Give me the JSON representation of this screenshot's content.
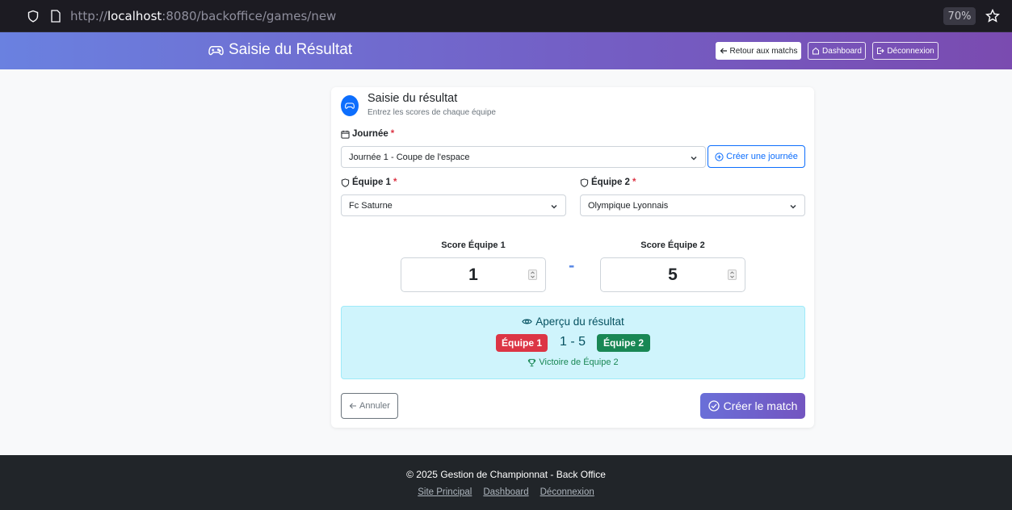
{
  "browser": {
    "url_prefix": "http://",
    "url_host": "localhost",
    "url_path": ":8080/backoffice/games/new",
    "zoom": "70%"
  },
  "header": {
    "title": "Saisie du Résultat",
    "back_label": "Retour aux matchs",
    "dashboard_label": "Dashboard",
    "logout_label": "Déconnexion"
  },
  "card": {
    "title": "Saisie du résultat",
    "subtitle": "Entrez les scores de chaque équipe",
    "journee_label": "Journée",
    "journee_value": "Journée 1 - Coupe de l'espace",
    "create_journee_label": "Créer une journée",
    "team1_label": "Équipe 1",
    "team1_value": "Fc Saturne",
    "team2_label": "Équipe 2",
    "team2_value": "Olympique Lyonnais",
    "required_mark": "*",
    "score1_label": "Score Équipe 1",
    "score1_value": "1",
    "score2_label": "Score Équipe 2",
    "score2_value": "5",
    "separator": "-"
  },
  "preview": {
    "title": "Aperçu du résultat",
    "team1_badge": "Équipe 1",
    "score": "1 - 5",
    "team2_badge": "Équipe 2",
    "result_text": "Victoire de Équipe 2"
  },
  "actions": {
    "cancel_label": "Annuler",
    "create_label": "Créer le match"
  },
  "footer": {
    "copyright": "© 2025 Gestion de Championnat - Back Office",
    "links": [
      "Site Principal",
      "Dashboard",
      "Déconnexion"
    ]
  },
  "colors": {
    "primary": "#0d6efd",
    "danger": "#dc3545",
    "success": "#198754",
    "info_bg": "#cff4fc",
    "header_gradient_start": "#6a81e0",
    "header_gradient_end": "#7a4bb0"
  }
}
